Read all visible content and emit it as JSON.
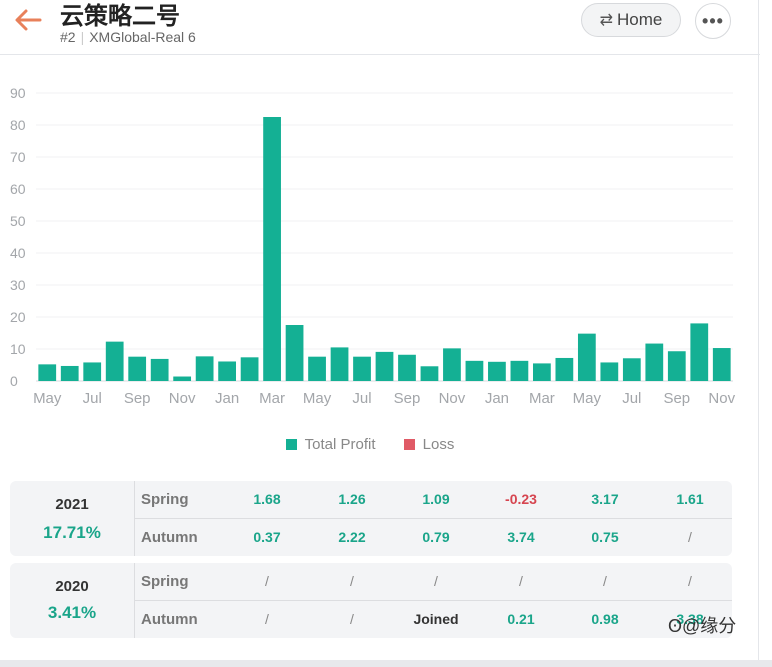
{
  "header": {
    "title": "云策略二号",
    "rank": "#2",
    "account": "XMGlobal-Real 6",
    "home_label": "Home",
    "more_label": "•••"
  },
  "colors": {
    "profit": "#14b094",
    "loss": "#e05a66",
    "accent": "#e8805a"
  },
  "chart_data": {
    "type": "bar",
    "categories": [
      "May",
      "Jun",
      "Jul",
      "Aug",
      "Sep",
      "Oct",
      "Nov",
      "Dec",
      "Jan",
      "Feb",
      "Mar",
      "Apr",
      "May",
      "Jun",
      "Jul",
      "Aug",
      "Sep",
      "Oct",
      "Nov",
      "Dec",
      "Jan",
      "Feb",
      "Mar",
      "Apr",
      "May",
      "Jun",
      "Jul",
      "Aug",
      "Sep",
      "Oct",
      "Nov"
    ],
    "tick_labels": [
      "May",
      "Jul",
      "Sep",
      "Nov",
      "Jan",
      "Mar",
      "May",
      "Jul",
      "Sep",
      "Nov",
      "Jan",
      "Mar",
      "May",
      "Jul",
      "Sep",
      "Nov"
    ],
    "series": [
      {
        "name": "Total Profit",
        "values": [
          5.2,
          4.7,
          5.8,
          12.3,
          7.6,
          6.9,
          1.4,
          7.7,
          6.1,
          7.4,
          82.5,
          17.5,
          7.6,
          10.5,
          7.6,
          9.1,
          8.2,
          4.6,
          10.2,
          6.3,
          6.0,
          6.3,
          5.5,
          7.2,
          14.8,
          5.8,
          7.1,
          11.7,
          9.3,
          18.0,
          10.3
        ]
      },
      {
        "name": "Loss",
        "values": [
          0,
          0,
          0,
          0,
          0,
          0,
          0,
          0,
          0,
          0,
          0,
          0,
          0,
          0,
          0,
          0,
          0,
          0,
          0,
          0,
          0,
          0,
          0,
          0,
          0,
          0,
          0,
          0,
          0,
          0,
          0
        ]
      }
    ],
    "yticks": [
      0,
      10,
      20,
      30,
      40,
      50,
      60,
      70,
      80,
      90
    ],
    "ylim": [
      0,
      90
    ],
    "grid": true,
    "legend_position": "bottom-center",
    "title": "",
    "xlabel": "",
    "ylabel": ""
  },
  "years": [
    {
      "year": "2021",
      "pct": "17.71%",
      "rows": [
        {
          "label": "Spring",
          "values": [
            "1.68",
            "1.26",
            "1.09",
            "-0.23",
            "3.17",
            "1.61"
          ]
        },
        {
          "label": "Autumn",
          "values": [
            "0.37",
            "2.22",
            "0.79",
            "3.74",
            "0.75",
            "/"
          ]
        }
      ]
    },
    {
      "year": "2020",
      "pct": "3.41%",
      "rows": [
        {
          "label": "Spring",
          "values": [
            "/",
            "/",
            "/",
            "/",
            "/",
            "/"
          ]
        },
        {
          "label": "Autumn",
          "values": [
            "/",
            "/",
            "Joined",
            "0.21",
            "0.98",
            "3.38"
          ]
        }
      ]
    }
  ],
  "watermark": "@缘分"
}
